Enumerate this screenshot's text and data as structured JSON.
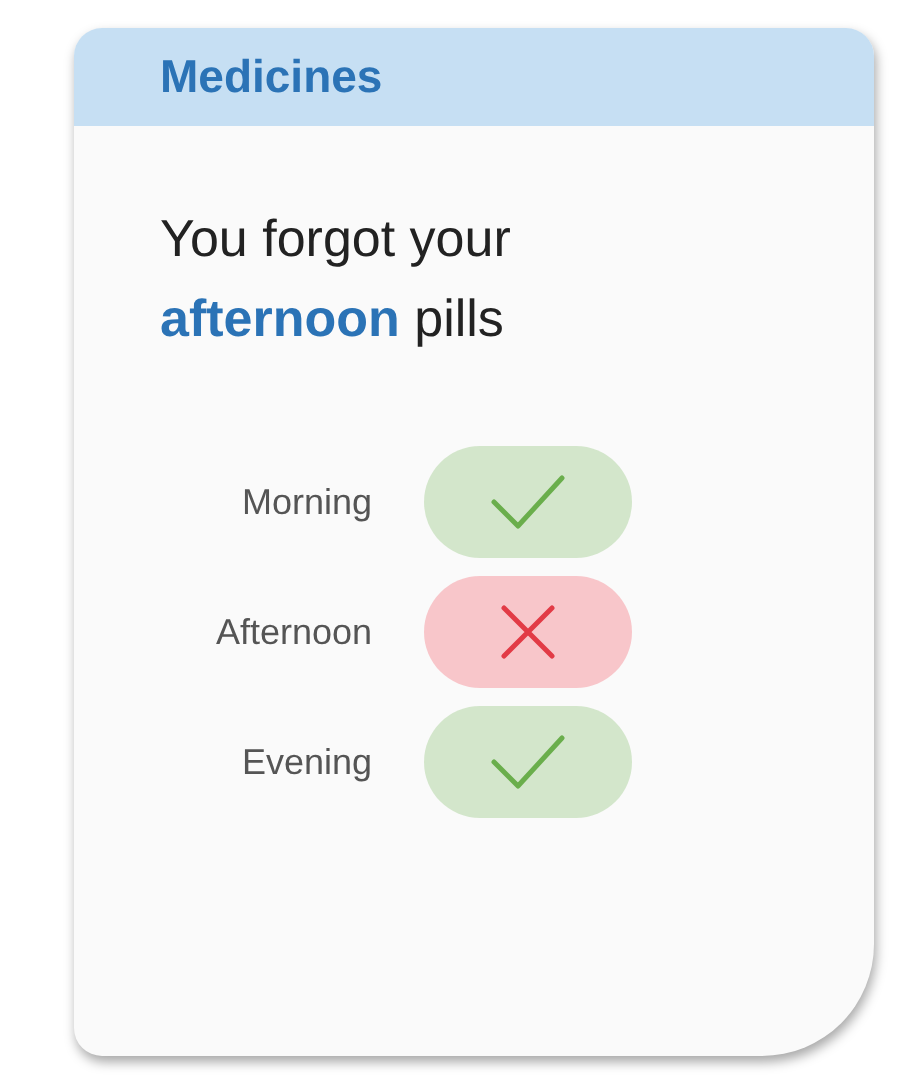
{
  "card": {
    "title": "Medicines",
    "message": "You forgot your **afternoon** pills",
    "doses": [
      {
        "label": "Morning",
        "taken": true
      },
      {
        "label": "Afternoon",
        "taken": false
      },
      {
        "label": "Evening",
        "taken": true
      }
    ]
  }
}
